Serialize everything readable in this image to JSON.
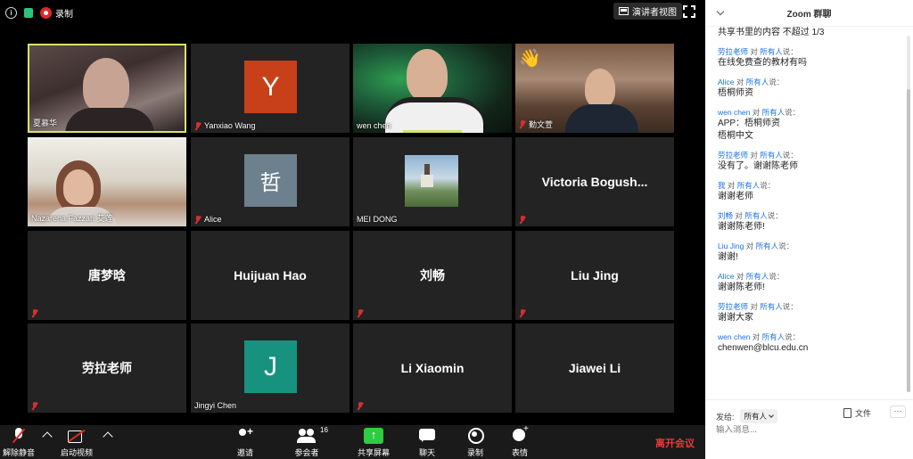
{
  "status": {
    "record_label": "录制"
  },
  "top": {
    "speaker_view_label": "演讲者视图"
  },
  "tiles": [
    {
      "name": "夏慕华",
      "has_video": true,
      "muted": false,
      "active": true
    },
    {
      "name": "Yanxiao Wang",
      "avatar_letter": "Y",
      "avatar_color": "#c8401a",
      "muted": true
    },
    {
      "name": "wen chen",
      "has_video": true,
      "muted": false,
      "speaking": true
    },
    {
      "name": "勤文萱",
      "has_video": true,
      "muted": true,
      "reaction": "👋"
    },
    {
      "name": "Nazarena Fazzari 艾莲",
      "has_video": true,
      "muted": false
    },
    {
      "name": "Alice",
      "avatar_letter": "哲",
      "avatar_color": "#6d808d",
      "muted": true
    },
    {
      "name": "MEI DONG",
      "has_picture": true,
      "muted": false
    },
    {
      "display_name": "Victoria  Bogush...",
      "muted": true
    },
    {
      "display_name": "唐梦晗",
      "muted": true
    },
    {
      "display_name": "Huijuan Hao",
      "muted": false
    },
    {
      "display_name": "刘畅",
      "muted": true
    },
    {
      "display_name": "Liu Jing",
      "muted": true
    },
    {
      "display_name": "劳拉老师",
      "muted": true
    },
    {
      "name": "Jingyi Chen",
      "avatar_letter": "J",
      "avatar_color": "#17927f",
      "muted": false
    },
    {
      "display_name": "Li Xiaomin",
      "muted": true
    },
    {
      "display_name": "Jiawei Li",
      "muted": false
    }
  ],
  "toolbar": {
    "unmute": "解除静音",
    "start_video": "启动视频",
    "invite": "邀请",
    "participants": "参会者",
    "participants_count": "16",
    "share": "共享屏幕",
    "chat": "聊天",
    "record": "录制",
    "reactions": "表情",
    "leave": "离开会议"
  },
  "chat": {
    "title": "Zoom 群聊",
    "to_word": "对",
    "said_suffix": "说：",
    "first_text": "共享书里的内容 不超过 1/3",
    "messages": [
      {
        "sender": "劳拉老师",
        "to": "所有人",
        "text": "在线免费查的教材有吗"
      },
      {
        "sender": "Alice",
        "to": "所有人",
        "text": "梧桐师资"
      },
      {
        "sender": "wen chen",
        "to": "所有人",
        "text": "APP：梧桐师资",
        "text2": "梧桐中文"
      },
      {
        "sender": "劳拉老师",
        "to": "所有人",
        "text": "没有了。谢谢陈老师"
      },
      {
        "sender": "我",
        "to": "所有人",
        "text": "谢谢老师"
      },
      {
        "sender": "刘畅",
        "to": "所有人",
        "text": "谢谢陈老师!"
      },
      {
        "sender": "Liu Jing",
        "to": "所有人",
        "text": "谢谢!"
      },
      {
        "sender": "Alice",
        "to": "所有人",
        "text": "谢谢陈老师!"
      },
      {
        "sender": "劳拉老师",
        "to": "所有人",
        "text": "谢谢大家"
      },
      {
        "sender": "wen chen",
        "to": "所有人",
        "text": "chenwen@blcu.edu.cn"
      }
    ],
    "send_to_label": "发给:",
    "send_to_value": "所有人",
    "file_label": "文件",
    "more_label": "···",
    "input_placeholder": "输入消息..."
  }
}
